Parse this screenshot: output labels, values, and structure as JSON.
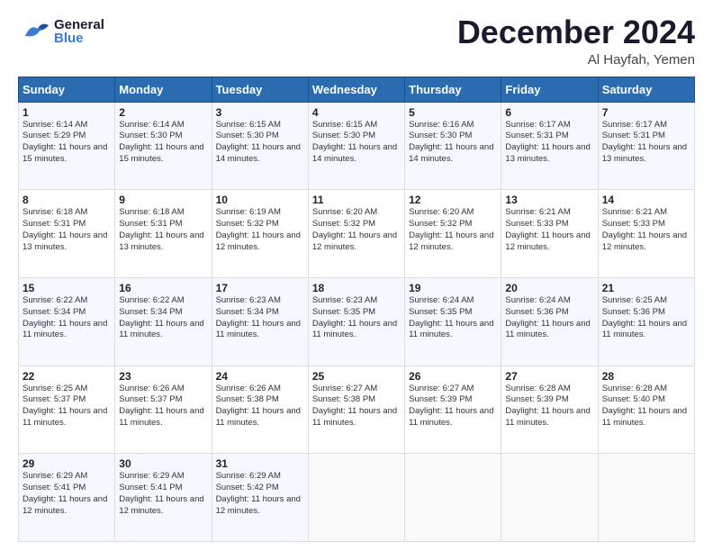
{
  "header": {
    "logo_general": "General",
    "logo_blue": "Blue",
    "month_title": "December 2024",
    "location": "Al Hayfah, Yemen"
  },
  "weekdays": [
    "Sunday",
    "Monday",
    "Tuesday",
    "Wednesday",
    "Thursday",
    "Friday",
    "Saturday"
  ],
  "weeks": [
    [
      {
        "day": "1",
        "sunrise": "6:14 AM",
        "sunset": "5:29 PM",
        "daylight": "11 hours and 15 minutes."
      },
      {
        "day": "2",
        "sunrise": "6:14 AM",
        "sunset": "5:30 PM",
        "daylight": "11 hours and 15 minutes."
      },
      {
        "day": "3",
        "sunrise": "6:15 AM",
        "sunset": "5:30 PM",
        "daylight": "11 hours and 14 minutes."
      },
      {
        "day": "4",
        "sunrise": "6:15 AM",
        "sunset": "5:30 PM",
        "daylight": "11 hours and 14 minutes."
      },
      {
        "day": "5",
        "sunrise": "6:16 AM",
        "sunset": "5:30 PM",
        "daylight": "11 hours and 14 minutes."
      },
      {
        "day": "6",
        "sunrise": "6:17 AM",
        "sunset": "5:31 PM",
        "daylight": "11 hours and 13 minutes."
      },
      {
        "day": "7",
        "sunrise": "6:17 AM",
        "sunset": "5:31 PM",
        "daylight": "11 hours and 13 minutes."
      }
    ],
    [
      {
        "day": "8",
        "sunrise": "6:18 AM",
        "sunset": "5:31 PM",
        "daylight": "11 hours and 13 minutes."
      },
      {
        "day": "9",
        "sunrise": "6:18 AM",
        "sunset": "5:31 PM",
        "daylight": "11 hours and 13 minutes."
      },
      {
        "day": "10",
        "sunrise": "6:19 AM",
        "sunset": "5:32 PM",
        "daylight": "11 hours and 12 minutes."
      },
      {
        "day": "11",
        "sunrise": "6:20 AM",
        "sunset": "5:32 PM",
        "daylight": "11 hours and 12 minutes."
      },
      {
        "day": "12",
        "sunrise": "6:20 AM",
        "sunset": "5:32 PM",
        "daylight": "11 hours and 12 minutes."
      },
      {
        "day": "13",
        "sunrise": "6:21 AM",
        "sunset": "5:33 PM",
        "daylight": "11 hours and 12 minutes."
      },
      {
        "day": "14",
        "sunrise": "6:21 AM",
        "sunset": "5:33 PM",
        "daylight": "11 hours and 12 minutes."
      }
    ],
    [
      {
        "day": "15",
        "sunrise": "6:22 AM",
        "sunset": "5:34 PM",
        "daylight": "11 hours and 11 minutes."
      },
      {
        "day": "16",
        "sunrise": "6:22 AM",
        "sunset": "5:34 PM",
        "daylight": "11 hours and 11 minutes."
      },
      {
        "day": "17",
        "sunrise": "6:23 AM",
        "sunset": "5:34 PM",
        "daylight": "11 hours and 11 minutes."
      },
      {
        "day": "18",
        "sunrise": "6:23 AM",
        "sunset": "5:35 PM",
        "daylight": "11 hours and 11 minutes."
      },
      {
        "day": "19",
        "sunrise": "6:24 AM",
        "sunset": "5:35 PM",
        "daylight": "11 hours and 11 minutes."
      },
      {
        "day": "20",
        "sunrise": "6:24 AM",
        "sunset": "5:36 PM",
        "daylight": "11 hours and 11 minutes."
      },
      {
        "day": "21",
        "sunrise": "6:25 AM",
        "sunset": "5:36 PM",
        "daylight": "11 hours and 11 minutes."
      }
    ],
    [
      {
        "day": "22",
        "sunrise": "6:25 AM",
        "sunset": "5:37 PM",
        "daylight": "11 hours and 11 minutes."
      },
      {
        "day": "23",
        "sunrise": "6:26 AM",
        "sunset": "5:37 PM",
        "daylight": "11 hours and 11 minutes."
      },
      {
        "day": "24",
        "sunrise": "6:26 AM",
        "sunset": "5:38 PM",
        "daylight": "11 hours and 11 minutes."
      },
      {
        "day": "25",
        "sunrise": "6:27 AM",
        "sunset": "5:38 PM",
        "daylight": "11 hours and 11 minutes."
      },
      {
        "day": "26",
        "sunrise": "6:27 AM",
        "sunset": "5:39 PM",
        "daylight": "11 hours and 11 minutes."
      },
      {
        "day": "27",
        "sunrise": "6:28 AM",
        "sunset": "5:39 PM",
        "daylight": "11 hours and 11 minutes."
      },
      {
        "day": "28",
        "sunrise": "6:28 AM",
        "sunset": "5:40 PM",
        "daylight": "11 hours and 11 minutes."
      }
    ],
    [
      {
        "day": "29",
        "sunrise": "6:29 AM",
        "sunset": "5:41 PM",
        "daylight": "11 hours and 12 minutes."
      },
      {
        "day": "30",
        "sunrise": "6:29 AM",
        "sunset": "5:41 PM",
        "daylight": "11 hours and 12 minutes."
      },
      {
        "day": "31",
        "sunrise": "6:29 AM",
        "sunset": "5:42 PM",
        "daylight": "11 hours and 12 minutes."
      },
      null,
      null,
      null,
      null
    ]
  ]
}
